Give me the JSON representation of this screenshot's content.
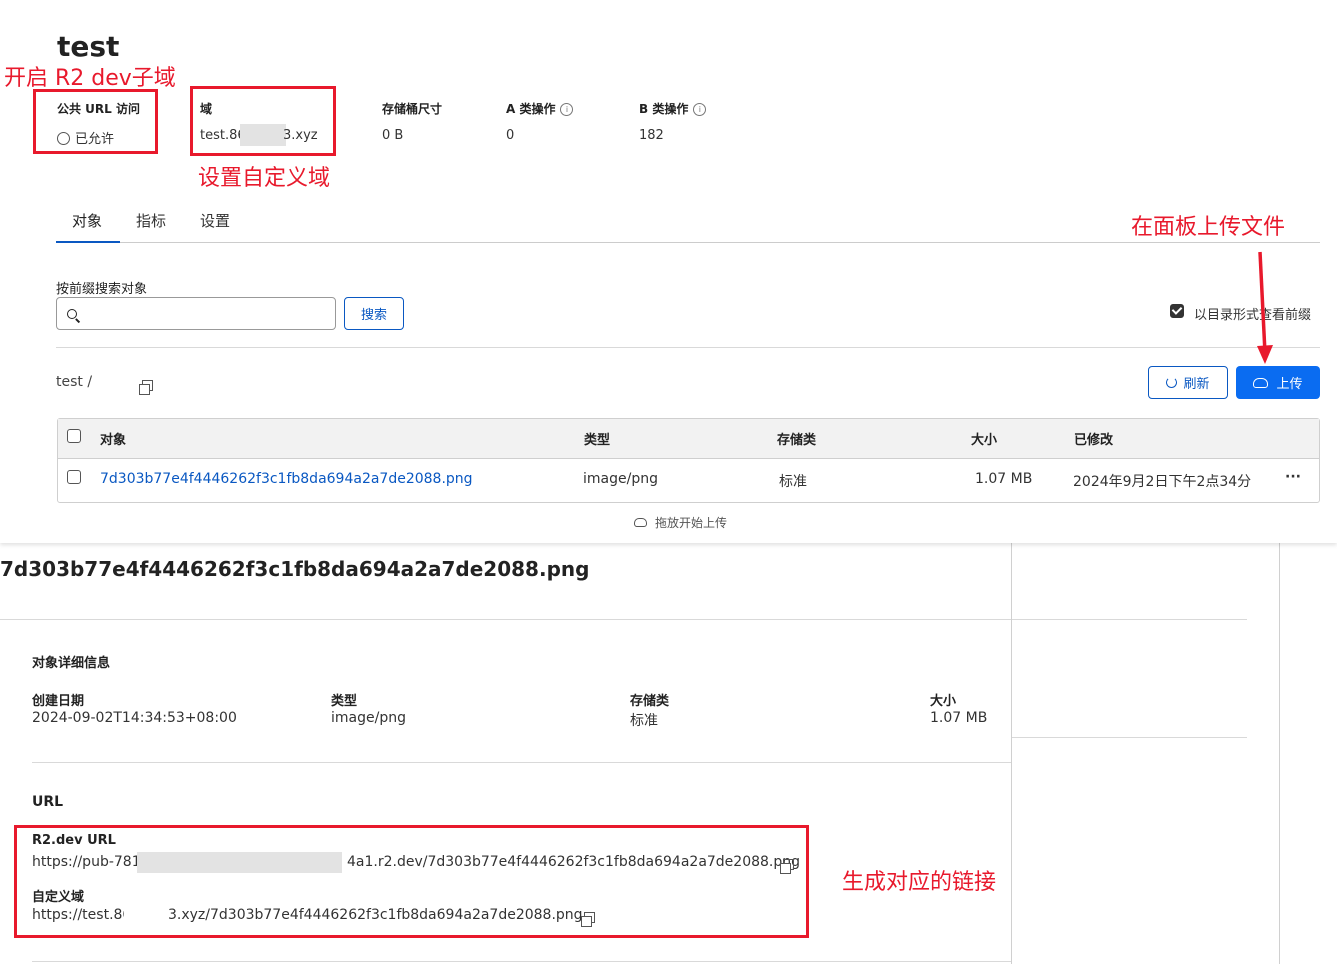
{
  "bucket": {
    "title": "test",
    "stats": {
      "public_url_label": "公共 URL 访问",
      "public_url_value": "已允许",
      "domain_label": "域",
      "domain_value_start": "test.86",
      "domain_value_end": "3.xyz",
      "size_label": "存储桶尺寸",
      "size_value": "0 B",
      "class_a_label": "A 类操作",
      "class_a_value": "0",
      "class_b_label": "B 类操作",
      "class_b_value": "182",
      "info_glyph": "i"
    },
    "tabs": [
      {
        "label": "对象"
      },
      {
        "label": "指标"
      },
      {
        "label": "设置"
      }
    ],
    "search": {
      "label": "按前缀搜索对象",
      "placeholder": "",
      "button": "搜索"
    },
    "view_prefix_label": "以目录形式查看前缀",
    "breadcrumb": "test /",
    "refresh_button": "刷新",
    "upload_button": "上传",
    "table": {
      "headers": [
        "对象",
        "类型",
        "存储类",
        "大小",
        "已修改"
      ],
      "rows": [
        {
          "name": "7d303b77e4f4446262f3c1fb8da694a2a7de2088.png",
          "type": "image/png",
          "storage": "标准",
          "size": "1.07 MB",
          "modified": "2024年9月2日下午2点34分"
        }
      ],
      "more_glyph": "···"
    },
    "drag_hint": "拖放开始上传"
  },
  "object": {
    "title": "7d303b77e4f4446262f3c1fb8da694a2a7de2088.png",
    "details_heading": "对象详细信息",
    "created_label": "创建日期",
    "created_value": "2024-09-02T14:34:53+08:00",
    "type_label": "类型",
    "type_value": "image/png",
    "storage_label": "存储类",
    "storage_value": "标准",
    "size_label": "大小",
    "size_value": "1.07 MB",
    "url_heading": "URL",
    "r2_label": "R2.dev URL",
    "r2_start": "https://pub-781",
    "r2_end": "4a1.r2.dev/7d303b77e4f4446262f3c1fb8da694a2a7de2088.png",
    "custom_label": "自定义域",
    "custom_start": "https://test.86",
    "custom_end": "3.xyz/7d303b77e4f4446262f3c1fb8da694a2a7de2088.png"
  },
  "annotations": {
    "enable_r2": "开启 R2 dev子域",
    "custom_domain": "设置自定义域",
    "upload_panel": "在面板上传文件",
    "generate_links": "生成对应的链接"
  },
  "colors": {
    "annotation_red": "#e8192c",
    "link_blue": "#0a58c2",
    "primary_blue": "#0a6cf1"
  }
}
